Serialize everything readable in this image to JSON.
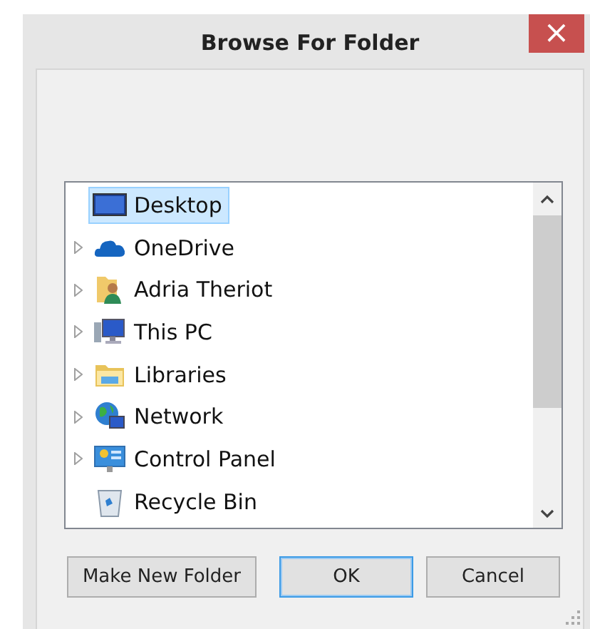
{
  "window": {
    "title": "Browse For Folder",
    "close": "×"
  },
  "tree": {
    "items": [
      {
        "label": "Desktop",
        "kind": "desktop",
        "expandable": false,
        "selected": true
      },
      {
        "label": "OneDrive",
        "kind": "cloud",
        "expandable": true,
        "selected": false
      },
      {
        "label": "Adria Theriot",
        "kind": "user",
        "expandable": true,
        "selected": false
      },
      {
        "label": "This PC",
        "kind": "computer",
        "expandable": true,
        "selected": false
      },
      {
        "label": "Libraries",
        "kind": "library",
        "expandable": true,
        "selected": false
      },
      {
        "label": "Network",
        "kind": "network",
        "expandable": true,
        "selected": false
      },
      {
        "label": "Control Panel",
        "kind": "control",
        "expandable": true,
        "selected": false
      },
      {
        "label": "Recycle Bin",
        "kind": "bin",
        "expandable": false,
        "selected": false
      }
    ]
  },
  "buttons": [
    {
      "label": "Make New Folder",
      "default": false
    },
    {
      "label": "OK",
      "default": true
    },
    {
      "label": "Cancel",
      "default": false
    }
  ]
}
